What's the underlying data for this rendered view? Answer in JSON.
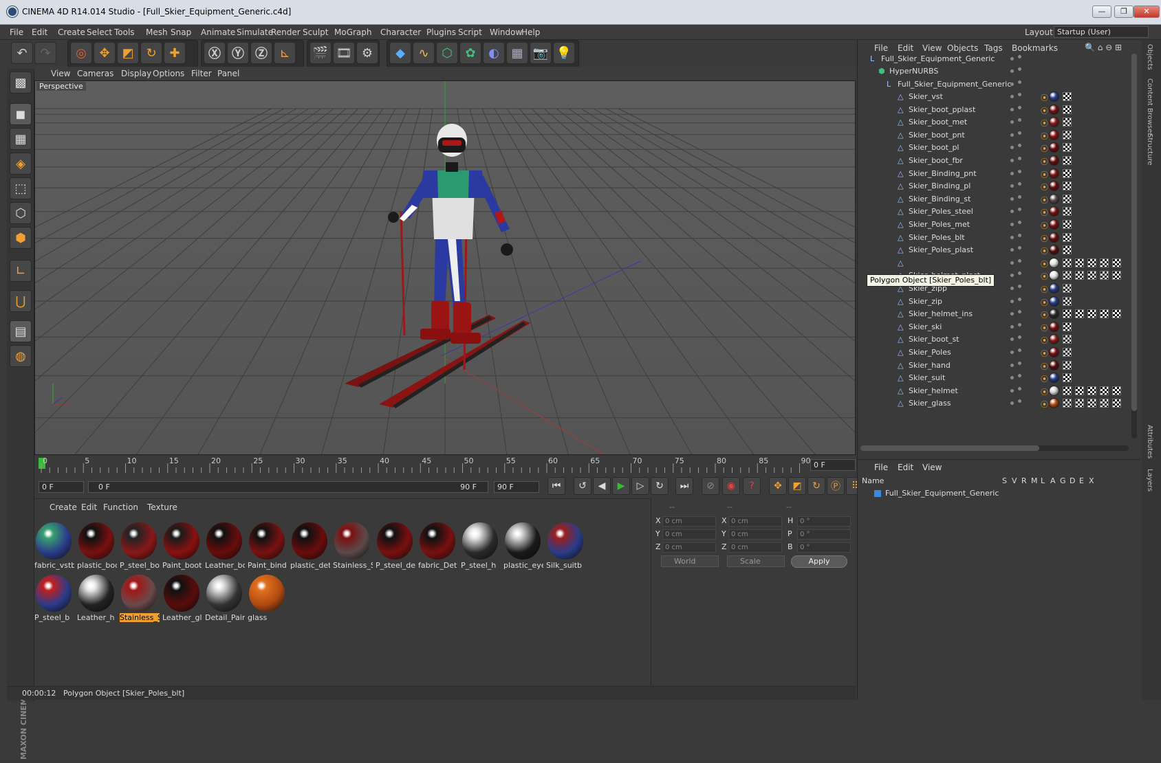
{
  "window": {
    "title": "CINEMA 4D R14.014 Studio - [Full_Skier_Equipment_Generic.c4d]",
    "minimize": "—",
    "maximize": "❐",
    "close": "✕"
  },
  "menubar": [
    "File",
    "Edit",
    "Create",
    "Select",
    "Tools",
    "Mesh",
    "Snap",
    "Animate",
    "Simulate",
    "Render",
    "Sculpt",
    "MoGraph",
    "Character",
    "Plugins",
    "Script",
    "Window",
    "Help"
  ],
  "layout": {
    "label": "Layout:",
    "value": "Startup (User)"
  },
  "viewport": {
    "menu": [
      "View",
      "Cameras",
      "Display",
      "Options",
      "Filter",
      "Panel"
    ],
    "label": "Perspective"
  },
  "timeline": {
    "ticks": [
      "0",
      "5",
      "10",
      "15",
      "20",
      "25",
      "30",
      "35",
      "40",
      "45",
      "50",
      "55",
      "60",
      "65",
      "70",
      "75",
      "80",
      "85",
      "90"
    ],
    "current_frame": "0 F"
  },
  "transport": {
    "start_field": "0 F",
    "range_start": "0 F",
    "range_end": "90 F",
    "end_field": "90 F"
  },
  "materials": {
    "menu": [
      "Create",
      "Edit",
      "Function",
      "Texture"
    ],
    "items": [
      {
        "label": "fabric_vstb",
        "color": "#2a3c8a",
        "accent": "#3aa070"
      },
      {
        "label": "plastic_boo",
        "color": "#7a1010",
        "accent": "#111111"
      },
      {
        "label": "P_steel_boo",
        "color": "#8a1818",
        "accent": "#222222"
      },
      {
        "label": "Paint_boot",
        "color": "#8a1010",
        "accent": "#1a1a1a"
      },
      {
        "label": "Leather_bo",
        "color": "#6a0c0c",
        "accent": "#111111"
      },
      {
        "label": "Paint_bind",
        "color": "#7a1212",
        "accent": "#111111"
      },
      {
        "label": "plastic_det",
        "color": "#6a0c0c",
        "accent": "#111111"
      },
      {
        "label": "Stainless_S",
        "color": "#5a4a4a",
        "accent": "#7a1212"
      },
      {
        "label": "P_steel_det",
        "color": "#7a1010",
        "accent": "#111111"
      },
      {
        "label": "fabric_Det",
        "color": "#7a1010",
        "accent": "#111111"
      },
      {
        "label": "P_steel_h",
        "color": "#2a2a2a",
        "accent": "#e8e8e8"
      },
      {
        "label": "plastic_eye",
        "color": "#1a1a1a",
        "accent": "#d8d8d8"
      },
      {
        "label": "Silk_suitb",
        "color": "#2a3c8a",
        "accent": "#9a2020"
      },
      {
        "label": "P_steel_b",
        "color": "#2a3c8a",
        "accent": "#c02020"
      },
      {
        "label": "Leather_h",
        "color": "#222222",
        "accent": "#e8e8e8"
      },
      {
        "label": "Stainless_S",
        "color": "#6a4a4a",
        "accent": "#a01818",
        "selected": true
      },
      {
        "label": "Leather_gl",
        "color": "#5a0c0c",
        "accent": "#111111"
      },
      {
        "label": "Detail_Pain",
        "color": "#333333",
        "accent": "#e0e0e0"
      },
      {
        "label": "glass",
        "color": "#b04a10",
        "accent": "#e07020"
      }
    ]
  },
  "coords": {
    "col_heads": [
      "--",
      "--",
      "--"
    ],
    "rows": [
      {
        "a": "X",
        "av": "0 cm",
        "b": "X",
        "bv": "0 cm",
        "c": "H",
        "cv": "0 °"
      },
      {
        "a": "Y",
        "av": "0 cm",
        "b": "Y",
        "bv": "0 cm",
        "c": "P",
        "cv": "0 °"
      },
      {
        "a": "Z",
        "av": "0 cm",
        "b": "Z",
        "bv": "0 cm",
        "c": "B",
        "cv": "0 °"
      }
    ],
    "world": "World",
    "scale": "Scale",
    "apply": "Apply"
  },
  "status": {
    "time": "00:00:12",
    "message": "Polygon Object [Skier_Poles_blt]"
  },
  "objects": {
    "menu": [
      "File",
      "Edit",
      "View",
      "Objects",
      "Tags",
      "Bookmarks"
    ],
    "tooltip": "Polygon Object [Skier_Poles_blt]",
    "root": "Full_Skier_Equipment_Generic",
    "hypernurbs": "HyperNURBS",
    "group": "Full_Skier_Equipment_Generic",
    "items": [
      {
        "name": "Skier_vst",
        "tag": "#2a3c8a",
        "extra": 0
      },
      {
        "name": "Skier_boot_pplast",
        "tag": "#7a1010",
        "extra": 0
      },
      {
        "name": "Skier_boot_met",
        "tag": "#8a1818",
        "extra": 0
      },
      {
        "name": "Skier_boot_pnt",
        "tag": "#8a1010",
        "extra": 0
      },
      {
        "name": "Skier_boot_pl",
        "tag": "#6a0c0c",
        "extra": 0
      },
      {
        "name": "Skier_boot_fbr",
        "tag": "#6a0c0c",
        "extra": 0
      },
      {
        "name": "Skier_Binding_pnt",
        "tag": "#7a1212",
        "extra": 0
      },
      {
        "name": "Skier_Binding_pl",
        "tag": "#6a0c0c",
        "extra": 0
      },
      {
        "name": "Skier_Binding_st",
        "tag": "#5a4a4a",
        "extra": 0
      },
      {
        "name": "Skier_Poles_steel",
        "tag": "#7a1010",
        "extra": 0
      },
      {
        "name": "Skier_Poles_met",
        "tag": "#7a1010",
        "extra": 0
      },
      {
        "name": "Skier_Poles_blt",
        "tag": "#6a0c0c",
        "extra": 0
      },
      {
        "name": "Skier_Poles_plast",
        "tag": "#5a0c0c",
        "extra": 0
      },
      {
        "name": "",
        "tag": "#dddddd",
        "extra": 4
      },
      {
        "name": "Skier_helmet_plast",
        "tag": "#e0e0e0",
        "extra": 4
      },
      {
        "name": "Skier_zipp",
        "tag": "#2a3c8a",
        "extra": 0
      },
      {
        "name": "Skier_zip",
        "tag": "#2a3c8a",
        "extra": 0
      },
      {
        "name": "Skier_helmet_ins",
        "tag": "#2a2a2a",
        "extra": 4
      },
      {
        "name": "Skier_ski",
        "tag": "#7a1010",
        "extra": 0
      },
      {
        "name": "Skier_boot_st",
        "tag": "#8a1818",
        "extra": 0
      },
      {
        "name": "Skier_Poles",
        "tag": "#7a1010",
        "extra": 0
      },
      {
        "name": "Skier_hand",
        "tag": "#5a0c0c",
        "extra": 0
      },
      {
        "name": "Skier_suit",
        "tag": "#2a3c8a",
        "extra": 0
      },
      {
        "name": "Skier_helmet",
        "tag": "#d0d0d0",
        "extra": 4
      },
      {
        "name": "Skier_glass",
        "tag": "#b04a10",
        "extra": 4
      }
    ]
  },
  "right_tabs": [
    "Objects",
    "Content Browser",
    "Structure",
    "Attributes",
    "Layers"
  ],
  "layers": {
    "menu": [
      "File",
      "Edit",
      "View"
    ],
    "headers": [
      "Name",
      "S",
      "V",
      "R",
      "M",
      "L",
      "A",
      "G",
      "D",
      "E",
      "X"
    ],
    "row": "Full_Skier_Equipment_Generic"
  }
}
